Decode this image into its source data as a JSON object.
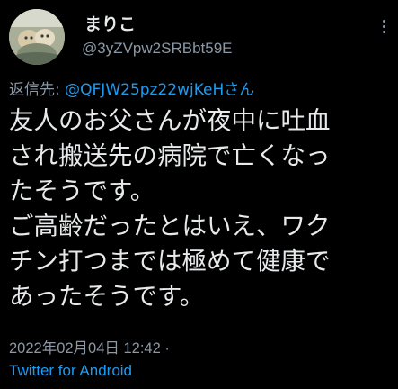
{
  "user": {
    "display_name": "まりこ",
    "handle": "@3yZVpw2SRBbt59E"
  },
  "reply": {
    "label": "返信先: ",
    "mention": "@QFJW25pz22wjKeHさん"
  },
  "body": {
    "lines": [
      "友人のお父さんが夜中に吐血",
      "され搬送先の病院で亡くなっ",
      "たそうです。",
      "ご高齢だったとはいえ、ワク",
      "チン打つまでは極めて健康で",
      "あったそうです。"
    ]
  },
  "meta": {
    "timestamp": "2022年02月04日 12:42 ·",
    "source": "Twitter for Android"
  },
  "colors": {
    "background": "#000000",
    "text": "#e7e9ea",
    "secondary": "#8b98a5",
    "link": "#1d9bf0"
  },
  "icons": {
    "more": "more-vertical-icon"
  }
}
